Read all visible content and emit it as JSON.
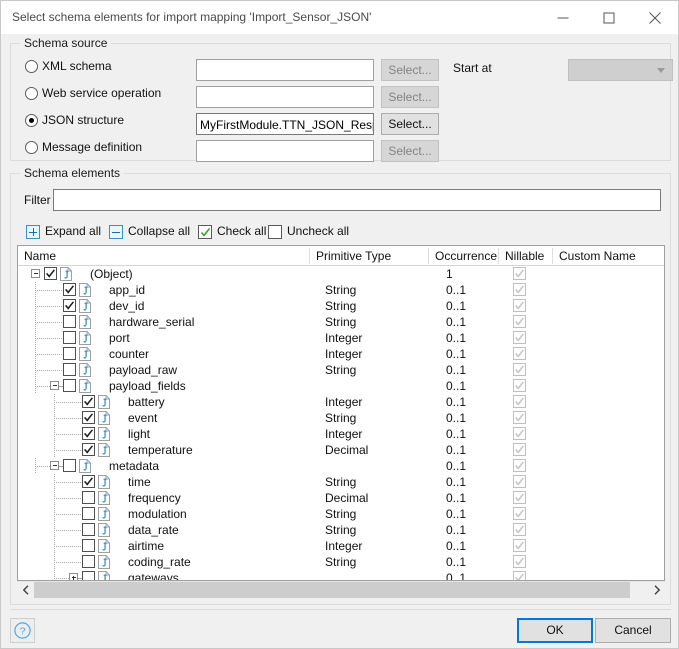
{
  "window": {
    "title": "Select schema elements for import mapping 'Import_Sensor_JSON'",
    "minimize_label": "Minimize",
    "maximize_label": "Maximize",
    "close_label": "Close"
  },
  "schema_source": {
    "legend": "Schema source",
    "start_at_label": "Start at",
    "start_at_value": "",
    "options": [
      {
        "label": "XML schema",
        "selected": false,
        "value": "",
        "button": "Select...",
        "button_enabled": false
      },
      {
        "label": "Web service operation",
        "selected": false,
        "value": "",
        "button": "Select...",
        "button_enabled": false
      },
      {
        "label": "JSON structure",
        "selected": true,
        "value": "MyFirstModule.TTN_JSON_Respo",
        "button": "Select...",
        "button_enabled": true
      },
      {
        "label": "Message definition",
        "selected": false,
        "value": "",
        "button": "Select...",
        "button_enabled": false
      }
    ]
  },
  "schema_elements": {
    "legend": "Schema elements",
    "filter_label": "Filter",
    "filter_value": "",
    "filter_placeholder": "",
    "toolbar": [
      {
        "label": "Expand all",
        "icon": "plus-box-icon"
      },
      {
        "label": "Collapse all",
        "icon": "minus-box-icon"
      },
      {
        "label": "Check all",
        "icon": "checked-box-icon"
      },
      {
        "label": "Uncheck all",
        "icon": "unchecked-box-icon"
      }
    ],
    "columns": [
      "Name",
      "Primitive Type",
      "Occurrence",
      "Nillable",
      "Custom Name"
    ],
    "rows": [
      {
        "name": "(Object)",
        "type": "",
        "occurrence": "1",
        "checked": true,
        "nillable": true,
        "depth": 0,
        "expander": "minus"
      },
      {
        "name": "app_id",
        "type": "String",
        "occurrence": "0..1",
        "checked": true,
        "nillable": true,
        "depth": 1,
        "expander": "none"
      },
      {
        "name": "dev_id",
        "type": "String",
        "occurrence": "0..1",
        "checked": true,
        "nillable": true,
        "depth": 1,
        "expander": "none"
      },
      {
        "name": "hardware_serial",
        "type": "String",
        "occurrence": "0..1",
        "checked": false,
        "nillable": true,
        "depth": 1,
        "expander": "none"
      },
      {
        "name": "port",
        "type": "Integer",
        "occurrence": "0..1",
        "checked": false,
        "nillable": true,
        "depth": 1,
        "expander": "none"
      },
      {
        "name": "counter",
        "type": "Integer",
        "occurrence": "0..1",
        "checked": false,
        "nillable": true,
        "depth": 1,
        "expander": "none"
      },
      {
        "name": "payload_raw",
        "type": "String",
        "occurrence": "0..1",
        "checked": false,
        "nillable": true,
        "depth": 1,
        "expander": "none"
      },
      {
        "name": "payload_fields",
        "type": "",
        "occurrence": "0..1",
        "checked": false,
        "nillable": true,
        "depth": 1,
        "expander": "minus"
      },
      {
        "name": "battery",
        "type": "Integer",
        "occurrence": "0..1",
        "checked": true,
        "nillable": true,
        "depth": 2,
        "expander": "none"
      },
      {
        "name": "event",
        "type": "String",
        "occurrence": "0..1",
        "checked": true,
        "nillable": true,
        "depth": 2,
        "expander": "none"
      },
      {
        "name": "light",
        "type": "Integer",
        "occurrence": "0..1",
        "checked": true,
        "nillable": true,
        "depth": 2,
        "expander": "none"
      },
      {
        "name": "temperature",
        "type": "Decimal",
        "occurrence": "0..1",
        "checked": true,
        "nillable": true,
        "depth": 2,
        "expander": "none"
      },
      {
        "name": "metadata",
        "type": "",
        "occurrence": "0..1",
        "checked": false,
        "nillable": true,
        "depth": 1,
        "expander": "minus"
      },
      {
        "name": "time",
        "type": "String",
        "occurrence": "0..1",
        "checked": true,
        "nillable": true,
        "depth": 2,
        "expander": "none"
      },
      {
        "name": "frequency",
        "type": "Decimal",
        "occurrence": "0..1",
        "checked": false,
        "nillable": true,
        "depth": 2,
        "expander": "none"
      },
      {
        "name": "modulation",
        "type": "String",
        "occurrence": "0..1",
        "checked": false,
        "nillable": true,
        "depth": 2,
        "expander": "none"
      },
      {
        "name": "data_rate",
        "type": "String",
        "occurrence": "0..1",
        "checked": false,
        "nillable": true,
        "depth": 2,
        "expander": "none"
      },
      {
        "name": "airtime",
        "type": "Integer",
        "occurrence": "0..1",
        "checked": false,
        "nillable": true,
        "depth": 2,
        "expander": "none"
      },
      {
        "name": "coding_rate",
        "type": "String",
        "occurrence": "0..1",
        "checked": false,
        "nillable": true,
        "depth": 2,
        "expander": "none"
      },
      {
        "name": "gateways",
        "type": "",
        "occurrence": "0..1",
        "checked": false,
        "nillable": true,
        "depth": 2,
        "expander": "plus"
      }
    ]
  },
  "footer": {
    "help_label": "Help",
    "ok_label": "OK",
    "cancel_label": "Cancel"
  },
  "colors": {
    "accent": "#0078d7",
    "window_bg": "#f0f0f0",
    "grid_bg": "#ffffff",
    "border": "#dcdcdc",
    "json_icon": "#3a8fc4",
    "check_green": "#3f9c35"
  }
}
